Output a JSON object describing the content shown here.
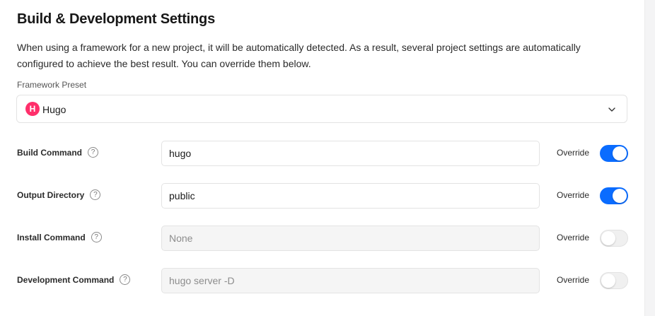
{
  "section": {
    "title": "Build & Development Settings",
    "description": "When using a framework for a new project, it will be automatically detected. As a result, several project settings are automatically configured to achieve the best result. You can override them below."
  },
  "framework_preset": {
    "label": "Framework Preset",
    "value": "Hugo",
    "logo_letter": "H",
    "logo_color": "#ff2f6b"
  },
  "settings": [
    {
      "label": "Build Command",
      "value": "hugo",
      "placeholder": "",
      "override_label": "Override",
      "override_on": true
    },
    {
      "label": "Output Directory",
      "value": "public",
      "placeholder": "",
      "override_label": "Override",
      "override_on": true
    },
    {
      "label": "Install Command",
      "value": "",
      "placeholder": "None",
      "override_label": "Override",
      "override_on": false
    },
    {
      "label": "Development Command",
      "value": "",
      "placeholder": "hugo server -D",
      "override_label": "Override",
      "override_on": false
    }
  ],
  "colors": {
    "accent": "#0a6cff",
    "toggle_off": "#f0f0f0"
  }
}
